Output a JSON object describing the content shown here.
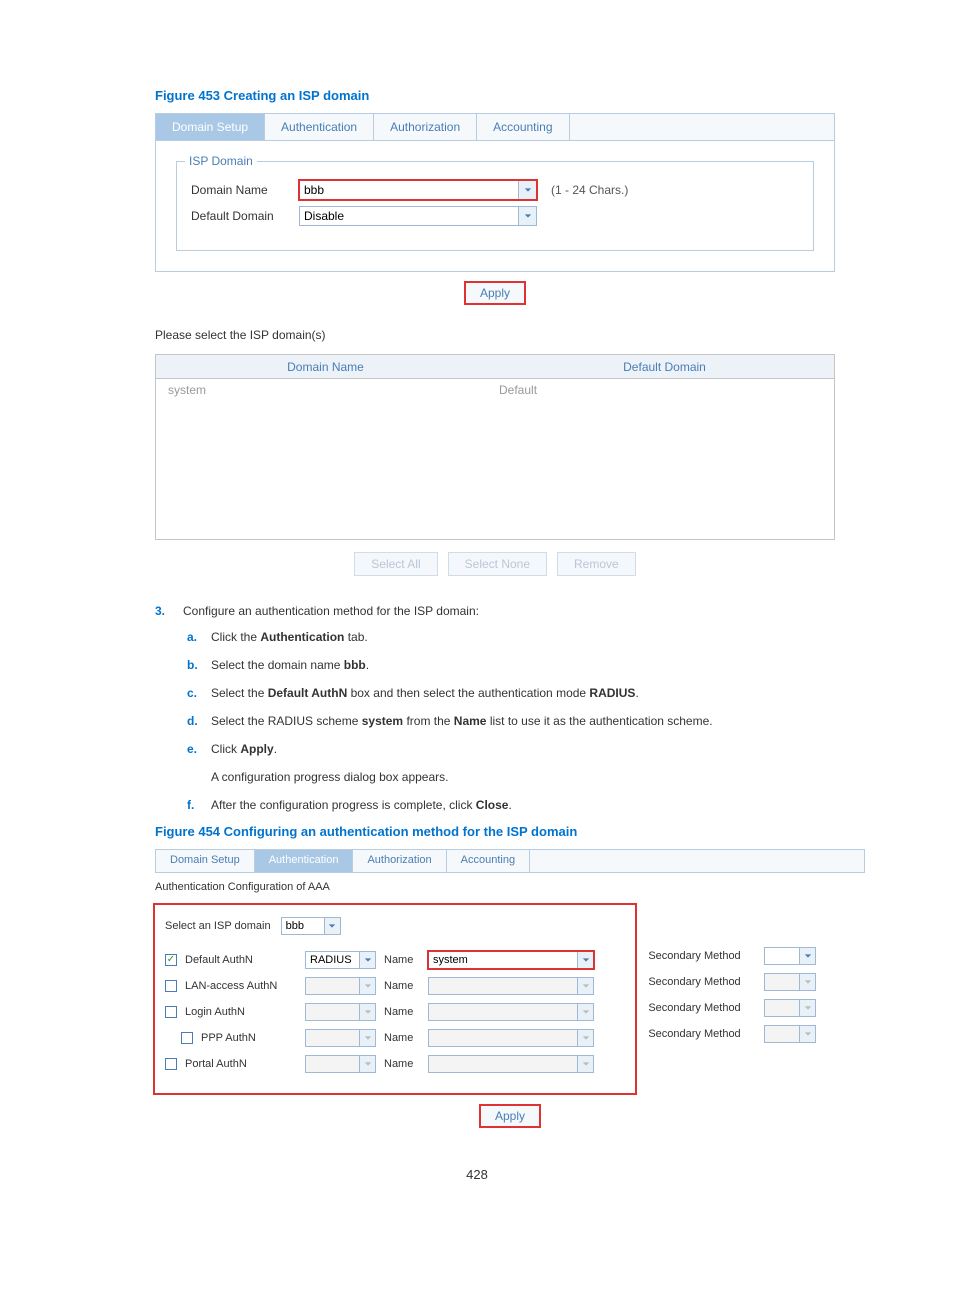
{
  "figure453": {
    "caption": "Figure 453 Creating an ISP domain"
  },
  "tabs1": {
    "domain_setup": "Domain Setup",
    "authentication": "Authentication",
    "authorization": "Authorization",
    "accounting": "Accounting"
  },
  "isp_fieldset": {
    "legend": "ISP Domain"
  },
  "domain_name": {
    "label": "Domain Name",
    "value": "bbb",
    "hint": "(1 - 24 Chars.)"
  },
  "default_domain": {
    "label": "Default Domain",
    "value": "Disable"
  },
  "apply_label": "Apply",
  "select_prompt": "Please select the ISP domain(s)",
  "table": {
    "col1": "Domain Name",
    "col2": "Default Domain",
    "row1": {
      "name": "system",
      "default": "Default"
    }
  },
  "buttons": {
    "select_all": "Select All",
    "select_none": "Select None",
    "remove": "Remove"
  },
  "step3": {
    "num": "3.",
    "text": "Configure an authentication method for the ISP domain:",
    "a": {
      "l": "a.",
      "t1": "Click the ",
      "b": "Authentication",
      "t2": " tab."
    },
    "b": {
      "l": "b.",
      "t1": "Select the domain name ",
      "b": "bbb",
      "t2": "."
    },
    "c": {
      "l": "c.",
      "t1": "Select the ",
      "b1": "Default AuthN",
      "t2": " box and then select the authentication mode ",
      "b2": "RADIUS",
      "t3": "."
    },
    "d": {
      "l": "d.",
      "t1": "Select the RADIUS scheme ",
      "b1": "system",
      "t2": " from the ",
      "b2": "Name",
      "t3": " list to use it as the authentication scheme."
    },
    "e": {
      "l": "e.",
      "t1": "Click ",
      "b": "Apply",
      "t2": ".",
      "note": "A configuration progress dialog box appears."
    },
    "f": {
      "l": "f.",
      "t1": "After the configuration progress is complete, click ",
      "b": "Close",
      "t2": "."
    }
  },
  "figure454": {
    "caption": "Figure 454 Configuring an authentication method for the ISP domain"
  },
  "tabs2": {
    "domain_setup": "Domain Setup",
    "authentication": "Authentication",
    "authorization": "Authorization",
    "accounting": "Accounting"
  },
  "aaa_title": "Authentication Configuration of AAA",
  "select_domain": {
    "label": "Select an ISP domain",
    "value": "bbb"
  },
  "name_label": "Name",
  "sec_label": "Secondary Method",
  "authn": {
    "default": {
      "label": "Default AuthN",
      "scheme": "RADIUS",
      "name": "system",
      "checked": true
    },
    "lan": {
      "label": "LAN-access AuthN"
    },
    "login": {
      "label": "Login AuthN"
    },
    "ppp": {
      "label": "PPP AuthN"
    },
    "portal": {
      "label": "Portal AuthN"
    }
  },
  "page_number": "428",
  "chart_data": null
}
